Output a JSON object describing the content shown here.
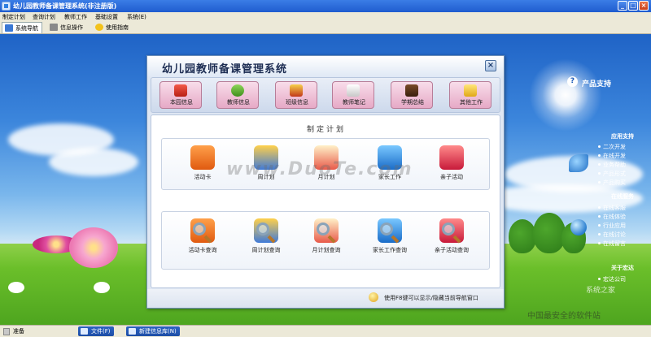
{
  "window": {
    "title": "幼儿园教师备课管理系统(非注册版)",
    "controls": [
      "_",
      "□",
      "×"
    ]
  },
  "menu": [
    "制定计划",
    "查询计划",
    "教师工作",
    "基础设置",
    "系统(E)"
  ],
  "nav_tabs": [
    {
      "label": "系统导航",
      "active": true
    },
    {
      "label": "信息操作",
      "active": false
    },
    {
      "label": "使用指南",
      "active": false
    }
  ],
  "dialog": {
    "title": "幼儿园教师备课管理系统",
    "close": "×",
    "top_tabs": [
      {
        "label": "本园信息",
        "icon": "house-icon"
      },
      {
        "label": "教师信息",
        "icon": "people-icon"
      },
      {
        "label": "班级信息",
        "icon": "home-icon"
      },
      {
        "label": "教师笔记",
        "icon": "pen-note-icon"
      },
      {
        "label": "学期总结",
        "icon": "book-icon"
      },
      {
        "label": "其他工作",
        "icon": "question-icon"
      }
    ],
    "section_title": "制定计划",
    "plan_items": [
      {
        "label": "活动卡",
        "icon": "rss-card-icon"
      },
      {
        "label": "周计划",
        "icon": "folder-week-icon"
      },
      {
        "label": "月计划",
        "icon": "calendar-month-icon"
      },
      {
        "label": "家长工作",
        "icon": "envelope-icon"
      },
      {
        "label": "亲子活动",
        "icon": "heart-family-icon"
      }
    ],
    "query_items": [
      {
        "label": "活动卡查询",
        "icon": "rss-search-icon"
      },
      {
        "label": "周计划查询",
        "icon": "folder-search-icon"
      },
      {
        "label": "月计划查询",
        "icon": "calendar-search-icon"
      },
      {
        "label": "家长工作查询",
        "icon": "envelope-search-icon"
      },
      {
        "label": "亲子活动查询",
        "icon": "heart-search-icon"
      }
    ],
    "arrow": "⇓",
    "footer_hint": "使用F8键可以显示/隐藏当前导航窗口"
  },
  "watermark": "www.DuoTe.com",
  "side_panel": {
    "title": "产品支持",
    "sections": [
      {
        "header": "应用支持",
        "links": [
          "二次开发",
          "在线开发",
          "业务帮助",
          "产品形式",
          "产品购买"
        ]
      },
      {
        "header": "在线服务",
        "links": [
          "在线客服",
          "在线体验",
          "行业应用",
          "在线讨论",
          "在线留言"
        ]
      },
      {
        "header": "关于宏达",
        "links": [
          "宏达公司"
        ]
      }
    ]
  },
  "corner_watermarks": [
    "系统之家",
    "中国最安全的软件站"
  ],
  "status": {
    "ready": "准备",
    "tasks": [
      "文件(F)",
      "新建信息库(N)"
    ]
  }
}
